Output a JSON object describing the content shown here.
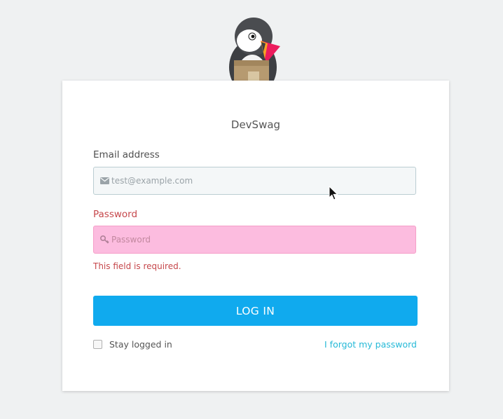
{
  "shop": {
    "name": "DevSwag"
  },
  "form": {
    "email": {
      "label": "Email address",
      "placeholder": "test@example.com",
      "value": ""
    },
    "password": {
      "label": "Password",
      "placeholder": "Password",
      "value": "",
      "error": "This field is required."
    },
    "login_button": "LOG IN",
    "stay_logged_in": "Stay logged in",
    "stay_logged_in_checked": false,
    "forgot_password": "I forgot my password"
  },
  "colors": {
    "page_background": "#eff1f2",
    "primary_button": "#10aaee",
    "error": "#c6474b",
    "error_field": "#fcbcdf",
    "link": "#25b9d7"
  },
  "icons": {
    "logo": "puffin-logo",
    "email": "envelope-icon",
    "password": "key-icon",
    "pointer": "mouse-cursor"
  }
}
